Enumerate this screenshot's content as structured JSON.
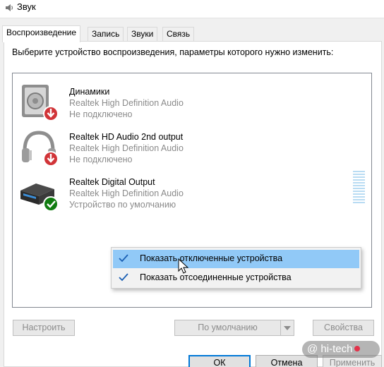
{
  "window": {
    "title": "Звук",
    "icon": "speaker-icon"
  },
  "tabs": [
    {
      "label": "Воспроизведение",
      "active": true
    },
    {
      "label": "Запись",
      "active": false
    },
    {
      "label": "Звуки",
      "active": false
    },
    {
      "label": "Связь",
      "active": false
    }
  ],
  "instructions": "Выберите устройство воспроизведения, параметры которого нужно изменить:",
  "devices": [
    {
      "name": "Динамики",
      "driver": "Realtek High Definition Audio",
      "status": "Не подключено",
      "icon": "speaker-icon",
      "badge": "disconnected-arrow-icon"
    },
    {
      "name": "Realtek HD Audio 2nd output",
      "driver": "Realtek High Definition Audio",
      "status": "Не подключено",
      "icon": "headphones-icon",
      "badge": "disconnected-arrow-icon"
    },
    {
      "name": "Realtek Digital Output",
      "driver": "Realtek High Definition Audio",
      "status": "Устройство по умолчанию",
      "icon": "digital-output-icon",
      "badge": "default-check-icon"
    }
  ],
  "context_menu": {
    "items": [
      {
        "label": "Показать отключенные устройства",
        "checked": true,
        "highlighted": true
      },
      {
        "label": "Показать отсоединенные устройства",
        "checked": true,
        "highlighted": false
      }
    ]
  },
  "buttons": {
    "configure": "Настроить",
    "set_default": "По умолчанию",
    "properties": "Свойства",
    "ok": "ОК",
    "cancel": "Отмена",
    "apply": "Применить"
  },
  "watermark": {
    "text": "hi-tech"
  },
  "colors": {
    "accent": "#0078d7",
    "menu_highlight": "#91c9f7",
    "disconnected_badge": "#d13438",
    "default_badge": "#107c10",
    "secondary_text": "#8a8a8a"
  }
}
